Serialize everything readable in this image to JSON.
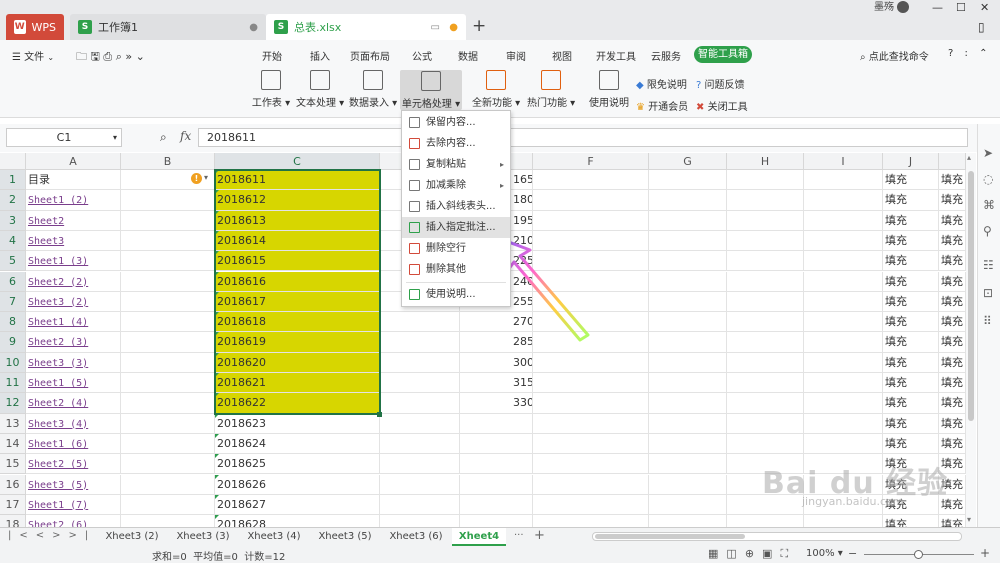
{
  "tabs": {
    "wps": "WPS",
    "book1": "工作簿1",
    "total": "总表.xlsx",
    "user": "墨殇"
  },
  "menu": {
    "file": "文件",
    "items": [
      "开始",
      "插入",
      "页面布局",
      "公式",
      "数据",
      "审阅",
      "视图",
      "开发工具",
      "云服务"
    ],
    "smart": "智能工具箱",
    "search": "点此查找命令"
  },
  "ribbon": {
    "buttons": [
      "工作表",
      "文本处理",
      "数据录入",
      "单元格处理",
      "全新功能",
      "热门功能",
      "使用说明"
    ],
    "small": [
      "限免说明",
      "问题反馈",
      "开通会员",
      "关闭工具"
    ]
  },
  "formula": {
    "namebox": "C1",
    "fx": "fx",
    "value": "2018611"
  },
  "columns": [
    "A",
    "B",
    "C",
    "D",
    "E",
    "F",
    "G",
    "H",
    "I",
    "J"
  ],
  "rows": [
    {
      "n": "1",
      "a": "目录",
      "c": "2018611",
      "e": "165",
      "j": "填充",
      "k": "填充"
    },
    {
      "n": "2",
      "a": "Sheet1 (2)",
      "c": "2018612",
      "e": "180",
      "j": "填充",
      "k": "填充"
    },
    {
      "n": "3",
      "a": "Sheet2",
      "c": "2018613",
      "e": "195",
      "j": "填充",
      "k": "填充"
    },
    {
      "n": "4",
      "a": "Sheet3",
      "c": "2018614",
      "e": "210",
      "j": "填充",
      "k": "填充"
    },
    {
      "n": "5",
      "a": "Sheet1 (3)",
      "c": "2018615",
      "e": "225",
      "j": "填充",
      "k": "填充"
    },
    {
      "n": "6",
      "a": "Sheet2 (2)",
      "c": "2018616",
      "e": "240",
      "j": "填充",
      "k": "填充"
    },
    {
      "n": "7",
      "a": "Sheet3 (2)",
      "c": "2018617",
      "e": "255",
      "j": "填充",
      "k": "填充"
    },
    {
      "n": "8",
      "a": "Sheet1 (4)",
      "c": "2018618",
      "e": "270",
      "j": "填充",
      "k": "填充"
    },
    {
      "n": "9",
      "a": "Sheet2 (3)",
      "c": "2018619",
      "e": "285",
      "j": "填充",
      "k": "填充"
    },
    {
      "n": "10",
      "a": "Sheet3 (3)",
      "c": "2018620",
      "e": "300",
      "j": "填充",
      "k": "填充"
    },
    {
      "n": "11",
      "a": "Sheet1 (5)",
      "c": "2018621",
      "e": "315",
      "j": "填充",
      "k": "填充"
    },
    {
      "n": "12",
      "a": "Sheet2 (4)",
      "c": "2018622",
      "e": "330",
      "j": "填充",
      "k": "填充"
    },
    {
      "n": "13",
      "a": "Sheet3 (4)",
      "c": "2018623",
      "e": "",
      "j": "填充",
      "k": "填充"
    },
    {
      "n": "14",
      "a": "Sheet1 (6)",
      "c": "2018624",
      "e": "",
      "j": "填充",
      "k": "填充"
    },
    {
      "n": "15",
      "a": "Sheet2 (5)",
      "c": "2018625",
      "e": "",
      "j": "填充",
      "k": "填充"
    },
    {
      "n": "16",
      "a": "Sheet3 (5)",
      "c": "2018626",
      "e": "",
      "j": "填充",
      "k": "填充"
    },
    {
      "n": "17",
      "a": "Sheet1 (7)",
      "c": "2018627",
      "e": "",
      "j": "填充",
      "k": "填充"
    },
    {
      "n": "18",
      "a": "Sheet2 (6)",
      "c": "2018628",
      "e": "",
      "j": "填充",
      "k": "填充"
    }
  ],
  "dropdown": [
    "保留内容...",
    "去除内容...",
    "复制粘贴",
    "加减乘除",
    "插入斜线表头...",
    "插入指定批注...",
    "删除空行",
    "删除其他",
    "使用说明..."
  ],
  "sheets": [
    "Xheet3 (2)",
    "Xheet3 (3)",
    "Xheet3 (4)",
    "Xheet3 (5)",
    "Xheet3 (6)",
    "Xheet4"
  ],
  "status": {
    "text": "求和=0  平均值=0  计数=12",
    "zoom": "100%"
  },
  "watermark": {
    "main": "Bai du 经验",
    "sub": "jingyan.baidu.com"
  },
  "colors": {
    "accent": "#2fa04b",
    "selection": "#d7d600",
    "wps_red": "#d24a3a"
  }
}
